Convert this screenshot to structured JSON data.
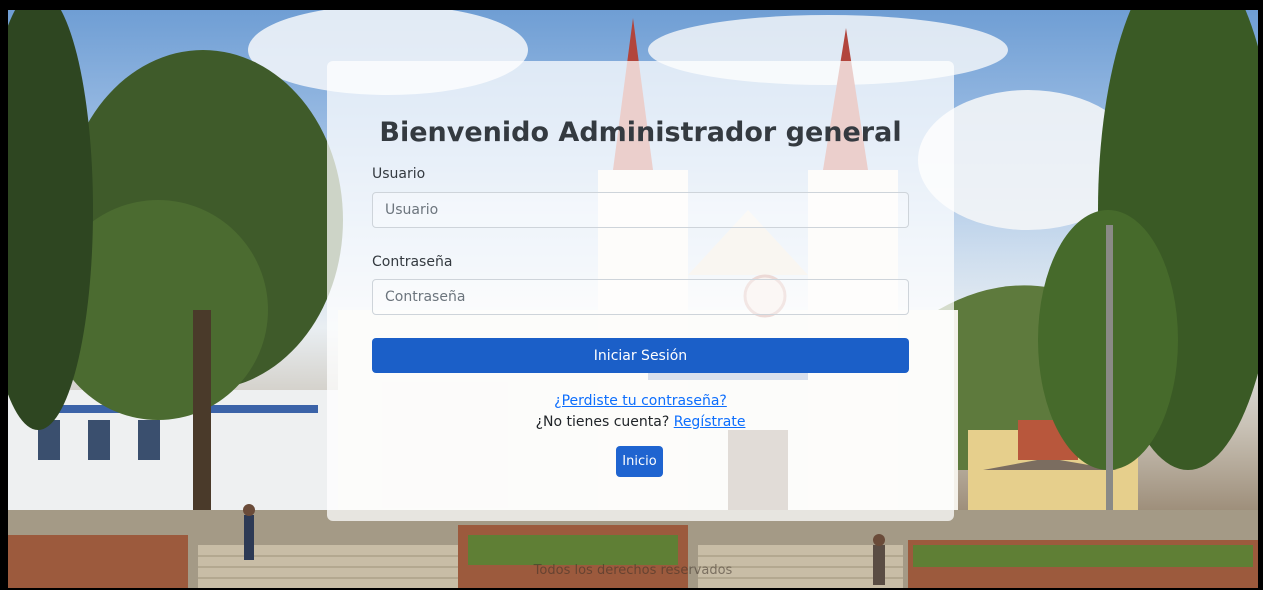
{
  "login": {
    "title": "Bienvenido Administrador general",
    "username_label": "Usuario",
    "username_placeholder": "Usuario",
    "password_label": "Contraseña",
    "password_placeholder": "Contraseña",
    "submit_label": "Iniciar Sesión",
    "forgot_password_link": "¿Perdiste tu contraseña?",
    "no_account_text": "¿No tienes cuenta?",
    "register_link": "Regístrate",
    "home_button": "Inicio"
  },
  "footer": {
    "text": "Todos los derechos reservados"
  },
  "colors": {
    "primary_button": "#1b5fc8",
    "link": "#0d6efd",
    "card_background": "rgba(255,255,255,0.74)"
  }
}
